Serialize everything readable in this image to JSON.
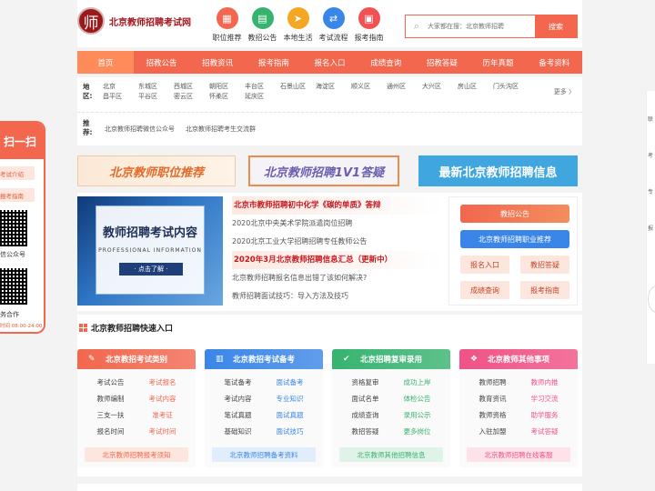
{
  "header": {
    "logo_char": "师",
    "logo_text": "北京教师招聘考试网",
    "quick_icons": [
      {
        "label": "职位推荐",
        "color": "#f2674e",
        "icon": "briefcase-icon",
        "glyph": "▦"
      },
      {
        "label": "教招公告",
        "color": "#37b36f",
        "icon": "calendar-icon",
        "glyph": "▤"
      },
      {
        "label": "本地生活",
        "color": "#f5a623",
        "icon": "send-icon",
        "glyph": "➤"
      },
      {
        "label": "考试流程",
        "color": "#3a86e8",
        "icon": "flow-icon",
        "glyph": "⇄"
      },
      {
        "label": "报考指南",
        "color": "#f05252",
        "icon": "guide-icon",
        "glyph": "▣"
      }
    ],
    "search_placeholder": "大家都在搜：北京教师招聘",
    "search_button": "搜索"
  },
  "nav": [
    "首页",
    "招教公告",
    "招教资讯",
    "报考指南",
    "报名入口",
    "成绩查询",
    "招教答疑",
    "历年真题",
    "备考资料"
  ],
  "filter": {
    "area_label": "地区:",
    "districts": [
      "北京",
      "东城区",
      "西城区",
      "朝阳区",
      "丰台区",
      "石景山区",
      "海淀区",
      "顺义区",
      "通州区",
      "大兴区",
      "房山区",
      "门头沟区",
      "昌平区",
      "平谷区",
      "密云区",
      "怀柔区",
      "延庆区"
    ],
    "more": "更多 〉",
    "rec_label": "推荐:",
    "recommends": [
      "北京教师招聘微信公众号",
      "北京教师招聘考生交流群"
    ]
  },
  "banners": [
    "北京教师职位推荐",
    "北京教师招聘1V1答疑",
    "最新北京教师招聘信息"
  ],
  "feature": {
    "title": "教师招聘考试内容",
    "subtitle": "PROFESSIONAL INFORMATION",
    "button": "· 点击了解 ·"
  },
  "news": [
    {
      "text": "北京市教师招聘初中化学《碳的单质》答辩",
      "highlight": true
    },
    {
      "text": "2020北京中央美术学院派遣岗位招聘",
      "highlight": false
    },
    {
      "text": "2020北京工业大学招聘招聘专任教师公告",
      "highlight": false
    },
    {
      "text": "2020年3月北京教师招聘信息汇总（更新中）",
      "highlight": true
    },
    {
      "text": "北京教师招聘报名信息出错了该如何解决?",
      "highlight": false
    },
    {
      "text": "教师招聘面试技巧：导入方法及技巧",
      "highlight": false
    }
  ],
  "sidebox": {
    "big_buttons": [
      "教招公告",
      "北京教师招聘职业推荐"
    ],
    "small_buttons": [
      "报名入口",
      "教招答疑",
      "成绩查询",
      "报考指南"
    ]
  },
  "quick": {
    "title": "北京教师招聘快速入口",
    "categories": [
      {
        "title": "北京教招考试类别",
        "color": "#f2674e",
        "foot_bg": "#fde6dd",
        "icon": "pencil-icon",
        "glyph": "✎",
        "links": [
          "考试公告",
          "考试报名",
          "教师编制",
          "考试内容",
          "三支一扶",
          "准考证",
          "报名时间",
          "考试时间"
        ],
        "foot": "北京教师招聘报考须知"
      },
      {
        "title": "北京教招考试备考",
        "color": "#3a86e8",
        "foot_bg": "#e2edfb",
        "icon": "book-icon",
        "glyph": "▥",
        "links": [
          "笔试备考",
          "面试备考",
          "考试内容",
          "专业知识",
          "笔试真题",
          "面试真题",
          "基础知识",
          "面试技巧"
        ],
        "foot": "北京教师招聘备考资料"
      },
      {
        "title": "北京招聘复审录用",
        "color": "#37b36f",
        "foot_bg": "#e0f3e8",
        "icon": "check-icon",
        "glyph": "✔",
        "links": [
          "资格复审",
          "成功上岸",
          "面试名单",
          "体检公告",
          "成绩查询",
          "录用公示",
          "教招答疑",
          "更多岗位"
        ],
        "foot": "北京教师其他招聘信息"
      },
      {
        "title": "北京教师其他事项",
        "color": "#f05285",
        "foot_bg": "#fde2ea",
        "icon": "grid-icon",
        "glyph": "❖",
        "links": [
          "教师招聘",
          "教师内推",
          "教育资讯",
          "学习交流",
          "教师资格",
          "助学服务",
          "入驻加盟",
          "考试答疑"
        ],
        "foot": "北京教师招聘在线客服"
      }
    ]
  },
  "left_float": {
    "head": "扫一扫",
    "tags": [
      "考试介绍",
      "报考指南"
    ],
    "text1": "信公众号",
    "text2": "务合作",
    "foot": "时间 08:00-24:00"
  },
  "right_float": [
    "联",
    "考",
    "专",
    "报"
  ]
}
